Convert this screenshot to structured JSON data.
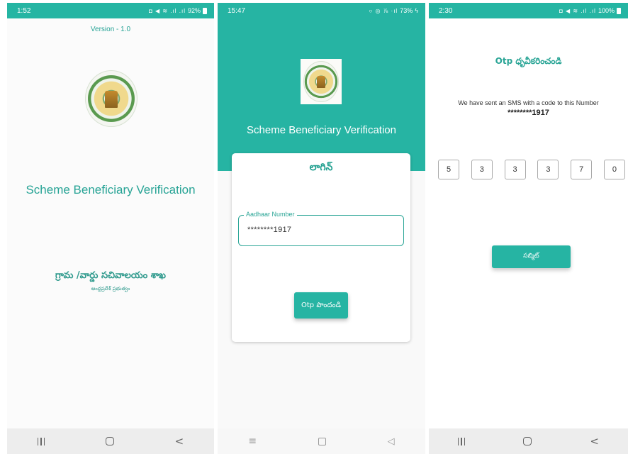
{
  "colors": {
    "primary": "#26b4a3",
    "text_primary": "#26a395",
    "field_border": "#2aa596"
  },
  "screen1": {
    "status": {
      "time": "1:52",
      "glyphs": "◘ ◀ ≋ .ıl .ıl",
      "battery": "92%"
    },
    "version": "Version - 1.0",
    "app_title": "Scheme Beneficiary Verification",
    "department_name": "గ్రామ /వార్డు సచివాలయం శాఖ",
    "department_sub": "ఆంధ్రప్రదేశ్ ప్రభుత్వం",
    "nav": {
      "recents_icon": "recents-icon",
      "home_icon": "home-icon",
      "back": "<"
    }
  },
  "screen2": {
    "status": {
      "time": "15:47",
      "glyphs": "○ ◎ ⅞ ·ıl",
      "battery": "73%"
    },
    "header_title": "Scheme Beneficiary Verification",
    "login_title": "లాగిన్",
    "aadhaar": {
      "label": "Aadhaar Number",
      "value": "********1917"
    },
    "otp_button": "Otp పొందండి",
    "nav": {
      "menu": "≡",
      "home_icon": "home-icon",
      "back": "◁"
    }
  },
  "screen3": {
    "status": {
      "time": "2:30",
      "glyphs": "◘ ◀ ≋ .ıl .ıl",
      "battery": "100%"
    },
    "otp_heading": "Otp ధృవీకరించండి",
    "sms_text": "We have sent an SMS with a code to this Number",
    "masked_number": "********1917",
    "otp_digits": [
      "5",
      "3",
      "3",
      "3",
      "7",
      "0"
    ],
    "submit_button": "సబ్మిట్",
    "nav": {
      "recents_icon": "recents-icon",
      "home_icon": "home-icon",
      "back": "<"
    }
  }
}
